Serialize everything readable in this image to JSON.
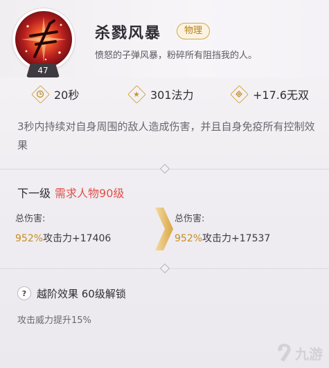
{
  "skill": {
    "name": "杀戮风暴",
    "type_badge": "物理",
    "tagline": "愤怒的子弹风暴，粉碎所有阻挡我的人。",
    "level": "47",
    "icon": "bullet-storm-skill-icon"
  },
  "stats": [
    {
      "icon": "clock-icon",
      "value": "20秒"
    },
    {
      "icon": "star-icon",
      "value": "301法力"
    },
    {
      "icon": "ward-icon",
      "value": "+17.6无双"
    }
  ],
  "description": "3秒内持续对自身周围的敌人造成伤害，并且自身免疫所有控制效果",
  "next_level": {
    "label": "下一级",
    "requirement": "需求人物90级",
    "current": {
      "label": "总伤害:",
      "percent": "952%",
      "rest": "攻击力+17406"
    },
    "next": {
      "label": "总伤害:",
      "percent": "952%",
      "rest": "攻击力+17537"
    }
  },
  "upgrade": {
    "icon_glyph": "?",
    "title": "越阶效果 60级解锁",
    "description": "攻击威力提升15%"
  },
  "watermark": {
    "text": "九游"
  },
  "colors": {
    "accent_gold": "#c98b1f",
    "requirement_red": "#e0504a",
    "badge_border": "#d7a54a"
  }
}
